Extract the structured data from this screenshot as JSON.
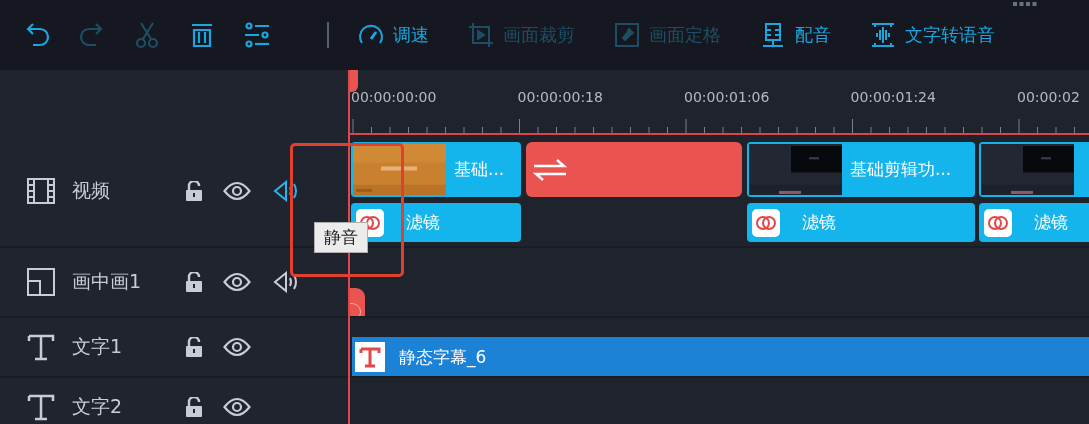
{
  "toolbar": [
    {
      "kind": "undo",
      "disabled": false
    },
    {
      "kind": "redo",
      "disabled": true
    },
    {
      "kind": "cut",
      "disabled": true
    },
    {
      "kind": "delete",
      "disabled": false
    },
    {
      "kind": "settings",
      "disabled": false
    },
    {
      "kind": "speed",
      "label": "调速",
      "disabled": false
    },
    {
      "kind": "crop",
      "label": "画面裁剪",
      "disabled": true
    },
    {
      "kind": "freeze",
      "label": "画面定格",
      "disabled": true
    },
    {
      "kind": "voiceover",
      "label": "配音",
      "disabled": false
    },
    {
      "kind": "tts",
      "label": "文字转语音",
      "disabled": false
    }
  ],
  "ruler": {
    "labels": [
      "00:00:00:00",
      "00:00:00:18",
      "00:00:01:06",
      "00:00:01:24",
      "00:00:02"
    ]
  },
  "tracks": [
    {
      "kind": "video",
      "name": "视频",
      "locked": false,
      "visible": true,
      "speaker_highlighted": true,
      "framed": true,
      "tooltip": "静音",
      "clips": [
        {
          "kind": "clip",
          "title": "基础...",
          "filter": "滤镜"
        },
        {
          "kind": "transition"
        },
        {
          "kind": "clip",
          "title": "基础剪辑功...",
          "filter": "滤镜"
        },
        {
          "kind": "clip",
          "filter": "滤镜"
        }
      ]
    },
    {
      "kind": "pip",
      "name": "画中画1",
      "locked": false,
      "visible": true,
      "speaker_highlighted": false,
      "framed": false
    },
    {
      "kind": "text",
      "name": "文字1",
      "locked": false,
      "visible": true,
      "framed": false,
      "clips": [
        {
          "kind": "text",
          "title": "静态字幕_6"
        }
      ]
    },
    {
      "kind": "text",
      "name": "文字2",
      "locked": false,
      "visible": true,
      "framed": false
    }
  ]
}
